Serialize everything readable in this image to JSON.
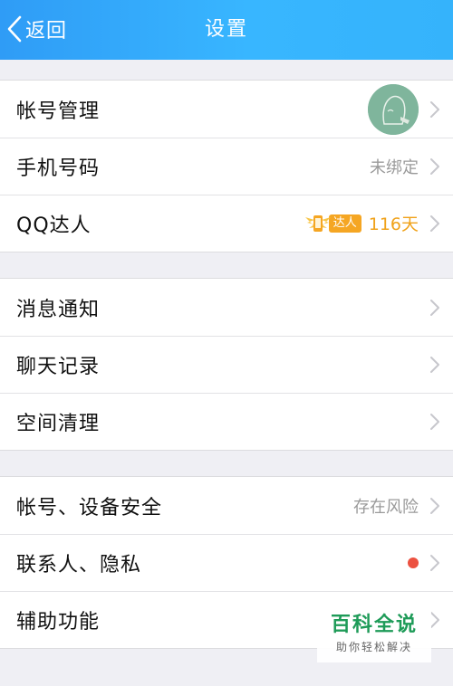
{
  "header": {
    "back_label": "返回",
    "title": "设置"
  },
  "groups": [
    {
      "items": [
        {
          "label": "帐号管理",
          "value": "",
          "type": "avatar"
        },
        {
          "label": "手机号码",
          "value": "未绑定"
        },
        {
          "label": "QQ达人",
          "badge": "达人",
          "days": "116天"
        }
      ]
    },
    {
      "items": [
        {
          "label": "消息通知"
        },
        {
          "label": "聊天记录"
        },
        {
          "label": "空间清理"
        }
      ]
    },
    {
      "items": [
        {
          "label": "帐号、设备安全",
          "value": "存在风险"
        },
        {
          "label": "联系人、隐私",
          "indicator": "red-dot"
        },
        {
          "label": "辅助功能"
        }
      ]
    }
  ],
  "colors": {
    "header_start": "#2f9cf6",
    "header_end": "#38b6ff",
    "daren": "#f5a623",
    "red_dot": "#ec5140",
    "watermark": "#1e9b58"
  },
  "watermark": {
    "title": "百科全说",
    "subtitle": "助你轻松解决"
  }
}
